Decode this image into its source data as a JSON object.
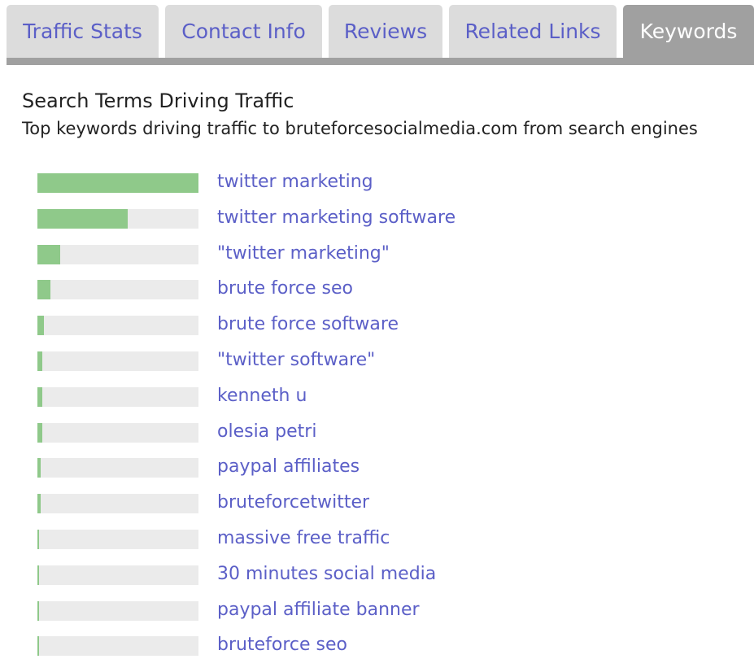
{
  "tabs": [
    {
      "label": "Traffic Stats",
      "active": false
    },
    {
      "label": "Contact Info",
      "active": false
    },
    {
      "label": "Reviews",
      "active": false
    },
    {
      "label": "Related Links",
      "active": false
    },
    {
      "label": "Keywords",
      "active": true
    }
  ],
  "section": {
    "title": "Search Terms Driving Traffic",
    "subtitle": "Top keywords driving traffic to bruteforcesocialmedia.com from search engines"
  },
  "colors": {
    "bar_fill": "#8fc98a",
    "bar_track": "#ebebeb",
    "link": "#5b5fc7",
    "active_tab": "#a0a0a0",
    "inactive_tab": "#dcdcdc"
  },
  "keywords": [
    {
      "term": "twitter marketing",
      "share": 1.0
    },
    {
      "term": "twitter marketing software",
      "share": 0.56
    },
    {
      "term": "\"twitter marketing\"",
      "share": 0.14
    },
    {
      "term": "brute force seo",
      "share": 0.08
    },
    {
      "term": "brute force software",
      "share": 0.04
    },
    {
      "term": "\"twitter software\"",
      "share": 0.03
    },
    {
      "term": "kenneth u",
      "share": 0.03
    },
    {
      "term": "olesia petri",
      "share": 0.03
    },
    {
      "term": "paypal affiliates",
      "share": 0.02
    },
    {
      "term": "bruteforcetwitter",
      "share": 0.02
    },
    {
      "term": "massive free traffic",
      "share": 0.01
    },
    {
      "term": "30 minutes social media",
      "share": 0.01
    },
    {
      "term": "paypal affiliate banner",
      "share": 0.01
    },
    {
      "term": "bruteforce seo",
      "share": 0.01
    }
  ]
}
